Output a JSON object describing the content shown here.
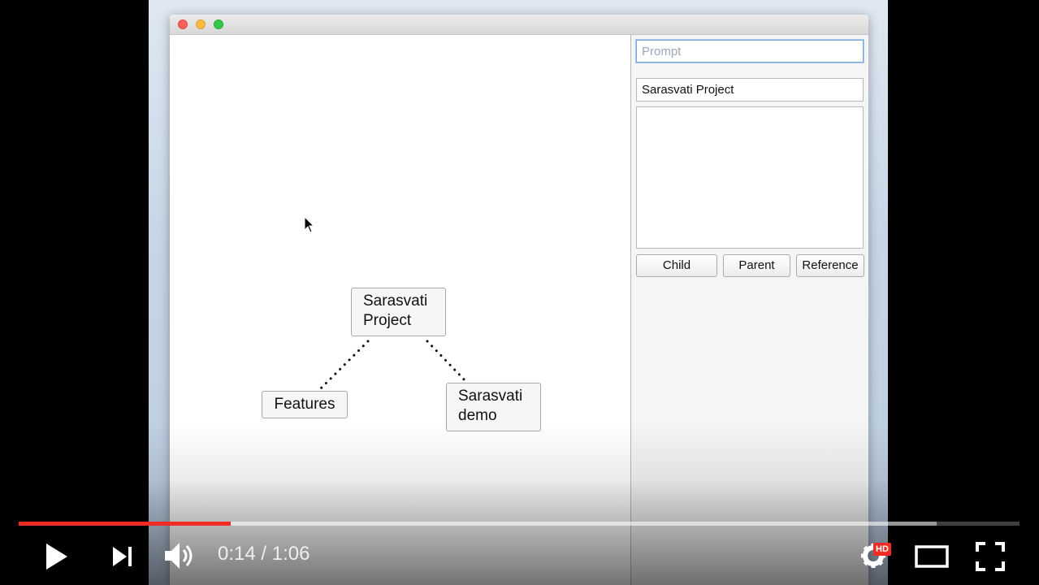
{
  "window": {
    "traffic_lights": [
      "close",
      "minimize",
      "maximize"
    ]
  },
  "graph": {
    "nodes": [
      {
        "id": "root",
        "label_line1": "Sarasvati",
        "label_line2": "Project"
      },
      {
        "id": "features",
        "label_line1": "Features"
      },
      {
        "id": "demo",
        "label_line1": "Sarasvati",
        "label_line2": "demo"
      }
    ],
    "edges": [
      {
        "from": "root",
        "to": "features",
        "style": "dotted"
      },
      {
        "from": "root",
        "to": "demo",
        "style": "dotted"
      }
    ]
  },
  "panel": {
    "prompt_placeholder": "Prompt",
    "title_value": "Sarasvati Project",
    "body_value": "",
    "buttons": {
      "child": "Child",
      "parent": "Parent",
      "reference": "Reference"
    }
  },
  "player": {
    "current_time": "0:14",
    "duration": "1:06",
    "time_display": "0:14 / 1:06",
    "progress_fraction": 0.212,
    "buffered_fraction": 0.917,
    "hd_badge": "HD",
    "colors": {
      "progress": "#f12b24"
    },
    "icons": [
      "play-icon",
      "next-icon",
      "volume-icon",
      "settings-icon",
      "theater-mode-icon",
      "fullscreen-icon"
    ]
  }
}
